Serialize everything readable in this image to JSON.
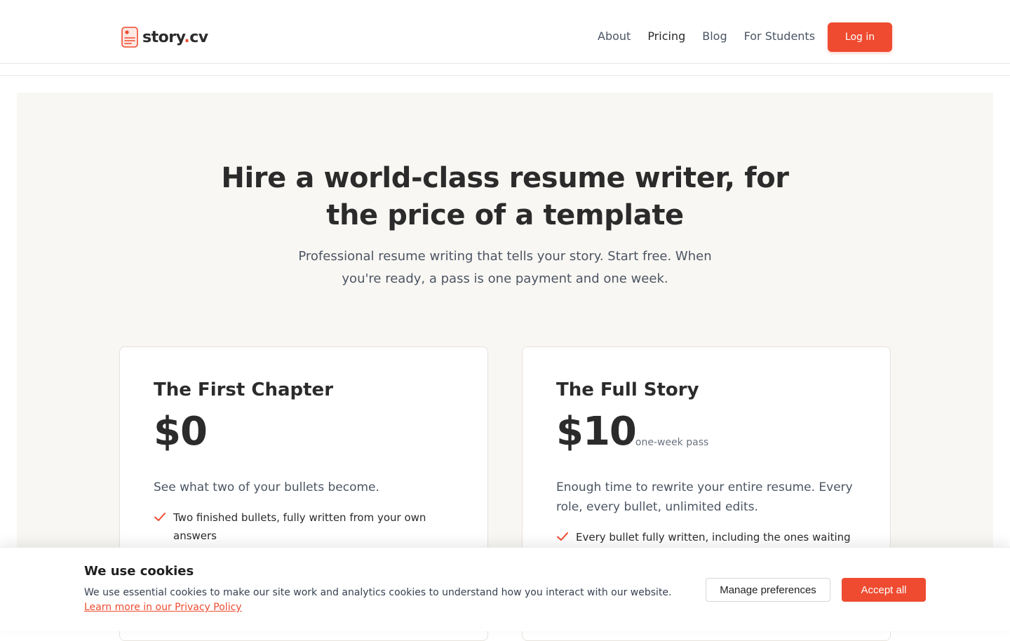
{
  "header": {
    "logo": {
      "text_main": "story",
      "text_dot": ".",
      "text_tail": "cv"
    },
    "nav": [
      {
        "label": "About"
      },
      {
        "label": "Pricing"
      },
      {
        "label": "Blog"
      },
      {
        "label": "For Students"
      }
    ],
    "login_label": "Log in"
  },
  "hero": {
    "title_line1": "Hire a world-class resume writer, for",
    "title_line2": "the price of a template",
    "subtitle_line1": "Professional resume writing that tells your story. Start free. When",
    "subtitle_line2": "you're ready, a pass is one payment and one week."
  },
  "plans": [
    {
      "name": "The First Chapter",
      "price": "$0",
      "price_note": "",
      "description": "See what two of your bullets become.",
      "features": [
        "Two finished bullets, fully written from your own answers"
      ]
    },
    {
      "name": "The Full Story",
      "price": "$10",
      "price_note": "· one-week pass",
      "description": "Enough time to rewrite your entire resume. Every role, every bullet, unlimited edits.",
      "features": [
        "Every bullet fully written, including the ones waiting"
      ]
    }
  ],
  "cookie_banner": {
    "title": "We use cookies",
    "text": "We use essential cookies to make our site work and analytics cookies to understand how you interact with our website.",
    "link_text": "Learn more in our Privacy Policy",
    "manage_label": "Manage preferences",
    "accept_label": "Accept all"
  },
  "colors": {
    "accent": "#ee4b30",
    "hero_bg": "#f9f7f3",
    "text_dark": "#2b2b2b",
    "text_muted": "#4b5563"
  }
}
